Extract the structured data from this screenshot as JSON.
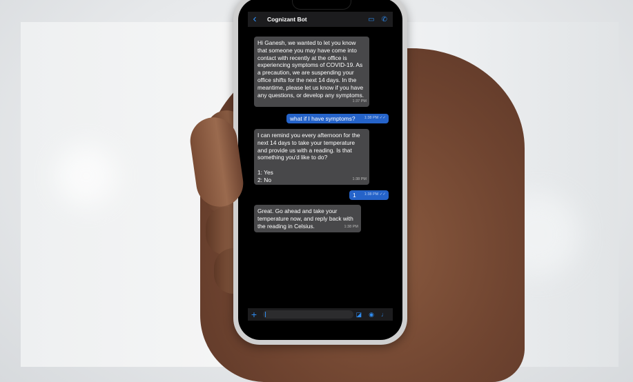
{
  "chat": {
    "header": {
      "back_icon": "chevron-left-icon",
      "title": "Cognizant Bot",
      "video_icon": "video-call-icon",
      "phone_icon": "phone-call-icon"
    },
    "messages": [
      {
        "direction": "incoming",
        "text": "Hi Ganesh, we wanted to let you know that someone you may have come into contact with recently at the office is experiencing symptoms of COVID-19. As a precaution, we are suspending your office shifts for the next 14 days. In the meantime, please let us know if you have any questions, or develop any symptoms.",
        "time": "1:37 PM"
      },
      {
        "direction": "outgoing",
        "text": "what if I have symptoms?",
        "time": "1:38 PM ✓✓"
      },
      {
        "direction": "incoming",
        "text": "I can remind you every afternoon for the next 14 days to take your temperature and provide us with a reading. Is that something you'd like to do?\n\n1: Yes\n2: No",
        "time": "1:38 PM"
      },
      {
        "direction": "outgoing",
        "text": "1",
        "time": "1:38 PM ✓✓"
      },
      {
        "direction": "incoming",
        "text": "Great. Go ahead and take your temperature now, and reply back with the reading in Celsius.",
        "time": "1:38 PM"
      }
    ],
    "composer": {
      "plus_icon": "plus-icon",
      "sticker_icon": "sticker-icon",
      "camera_icon": "camera-icon",
      "mic_icon": "microphone-icon"
    }
  }
}
